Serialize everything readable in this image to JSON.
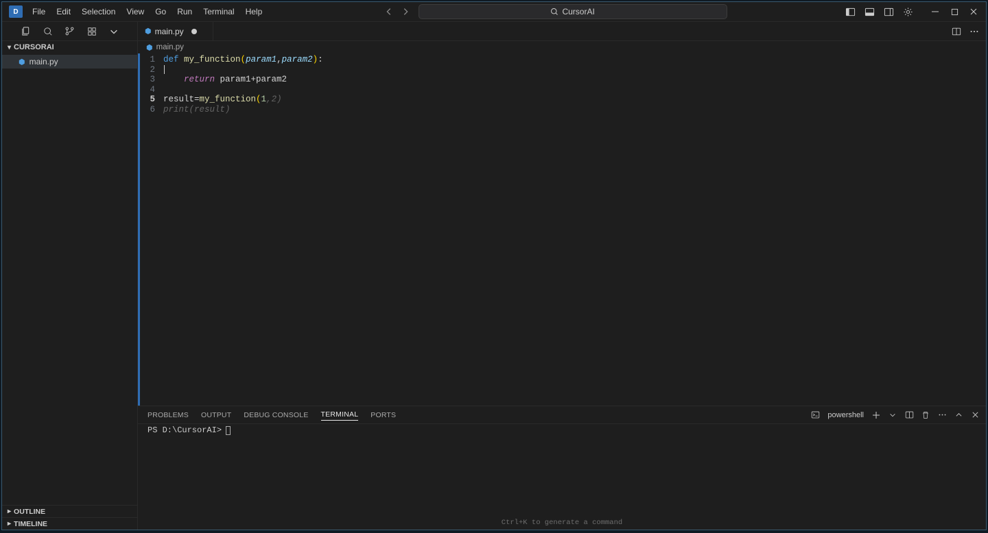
{
  "app_logo_letter": "D",
  "menu": {
    "file": "File",
    "edit": "Edit",
    "selection": "Selection",
    "view": "View",
    "go": "Go",
    "run": "Run",
    "terminal": "Terminal",
    "help": "Help"
  },
  "search_label": "CursorAI",
  "explorer": {
    "header": "CURSORAI",
    "items": [
      {
        "name": "main.py"
      }
    ]
  },
  "sidebar_sections": {
    "outline": "OUTLINE",
    "timeline": "TIMELINE"
  },
  "tab": {
    "filename": "main.py",
    "modified": true
  },
  "breadcrumb": {
    "file": "main.py"
  },
  "code": {
    "line_numbers": [
      "1",
      "2",
      "3",
      "4",
      "5",
      "6"
    ],
    "active_line_index": 4,
    "l1_def": "def",
    "l1_fn": "my_function",
    "l1_p1": "param1",
    "l1_p2": "param2",
    "l3_ret": "return",
    "l3_expr": "param1+param2",
    "l5_lhs": "result=",
    "l5_fn": "my_function",
    "l5_arg1": "1",
    "l5_ghost_arg2": ",2)",
    "l6_ghost": "print(result)"
  },
  "panel": {
    "tabs": {
      "problems": "PROBLEMS",
      "output": "OUTPUT",
      "debug": "DEBUG CONSOLE",
      "terminal": "TERMINAL",
      "ports": "PORTS"
    },
    "shell_name": "powershell",
    "prompt": "PS D:\\CursorAI>",
    "hint": "Ctrl+K to generate a command"
  }
}
